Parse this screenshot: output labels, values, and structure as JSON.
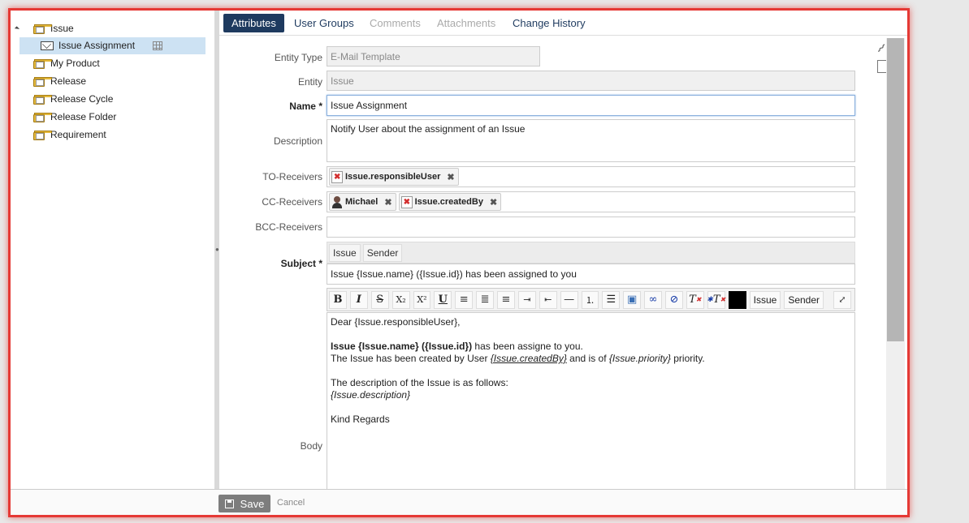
{
  "tree": {
    "items": [
      {
        "label": "Issue",
        "type": "folder",
        "expanded": true
      },
      {
        "label": "Issue Assignment",
        "type": "email-template",
        "selected": true
      },
      {
        "label": "My Product",
        "type": "folder"
      },
      {
        "label": "Release",
        "type": "folder"
      },
      {
        "label": "Release Cycle",
        "type": "folder"
      },
      {
        "label": "Release Folder",
        "type": "folder"
      },
      {
        "label": "Requirement",
        "type": "folder"
      }
    ]
  },
  "tabs": [
    {
      "label": "Attributes",
      "state": "active"
    },
    {
      "label": "User Groups",
      "state": "enabled"
    },
    {
      "label": "Comments",
      "state": "disabled"
    },
    {
      "label": "Attachments",
      "state": "disabled"
    },
    {
      "label": "Change History",
      "state": "enabled"
    }
  ],
  "form": {
    "entity_type": {
      "label": "Entity Type",
      "value": "E-Mail Template"
    },
    "entity": {
      "label": "Entity",
      "value": "Issue"
    },
    "name": {
      "label": "Name",
      "required_mark": "*",
      "value": "Issue Assignment"
    },
    "description": {
      "label": "Description",
      "value": "Notify User about the assignment of an Issue"
    },
    "to_receivers": {
      "label": "TO-Receivers",
      "chips": [
        {
          "label": "Issue.responsibleUser",
          "icon": "document-error-icon"
        }
      ]
    },
    "cc_receivers": {
      "label": "CC-Receivers",
      "chips": [
        {
          "label": "Michael",
          "icon": "user-icon"
        },
        {
          "label": "Issue.createdBy",
          "icon": "document-error-icon"
        }
      ]
    },
    "bcc_receivers": {
      "label": "BCC-Receivers"
    },
    "subject": {
      "label": "Subject",
      "required_mark": "*",
      "variables": [
        "Issue",
        "Sender"
      ],
      "value": "Issue {Issue.name} ({Issue.id}) has been assigned to you"
    },
    "body": {
      "label": "Body",
      "toolbar_variables": [
        "Issue",
        "Sender"
      ],
      "greeting": "Dear {Issue.responsibleUser},",
      "line1_bold": "Issue {Issue.name} ({Issue.id})",
      "line1_rest": " has been assigne to you.",
      "line2_pre": "The Issue has been created by User ",
      "line2_var1": "{Issue.createdBy}",
      "line2_mid": " and is of ",
      "line2_var2": "{Issue.priority}",
      "line2_post": " priority.",
      "line3": "The description of the Issue is as follows:",
      "line4_var": "{Issue.description}",
      "closing": "Kind Regards"
    }
  },
  "footer": {
    "save_label": "Save",
    "cancel_label": "Cancel"
  },
  "colors": {
    "accent": "#1e3a5f",
    "frame": "#e53935",
    "selected": "#cde2f3"
  }
}
